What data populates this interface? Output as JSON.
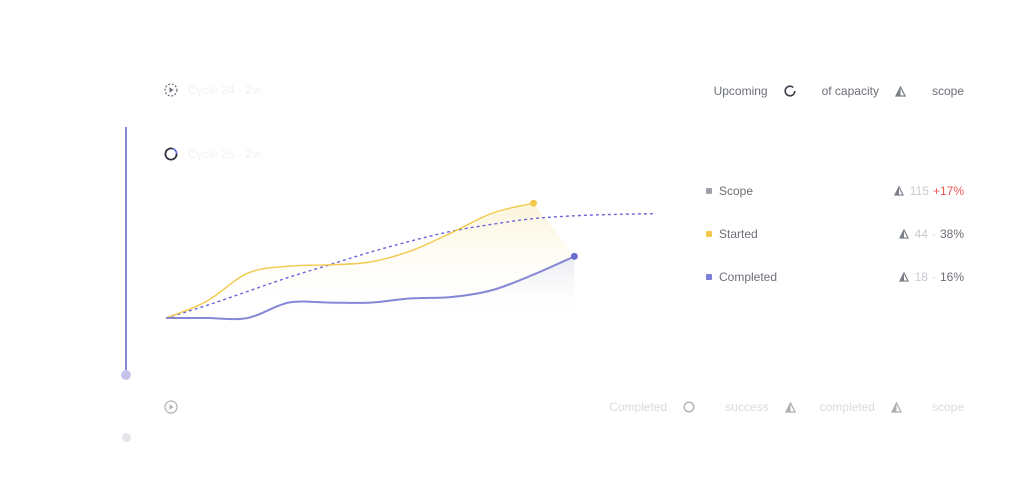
{
  "previous_cycle": {
    "name": "Cycle 24 · 2w"
  },
  "active_cycle": {
    "name": "Cycle 25 · 2w",
    "upcoming_label": "Upcoming",
    "capacity_label": "of capacity",
    "scope_label": "scope"
  },
  "next_cycle": {
    "completed_label": "Completed",
    "success_label": "success",
    "completed_count_label": "completed",
    "scope_label": "scope"
  },
  "legend": [
    {
      "label": "Scope",
      "count": "115",
      "change": "+17%",
      "color": "#9ea1a8"
    },
    {
      "label": "Started",
      "count": "44",
      "percent": "38%",
      "color": "#f2c94c"
    },
    {
      "label": "Completed",
      "count": "18",
      "percent": "16%",
      "color": "#7c7fd3"
    }
  ],
  "chart_data": {
    "type": "line",
    "x": [
      0,
      1,
      2,
      3,
      4,
      5,
      6,
      7,
      8,
      9,
      10,
      11,
      12
    ],
    "series": [
      {
        "name": "Scope",
        "style": "dashed",
        "values": [
          0,
          9,
          19,
          29,
          38,
          47,
          55,
          62,
          67,
          71,
          73,
          74,
          74.5
        ]
      },
      {
        "name": "Started",
        "values": [
          0,
          12,
          32,
          37,
          38,
          40,
          48,
          61,
          75,
          82
        ]
      },
      {
        "name": "Completed",
        "values": [
          0,
          0,
          0,
          11,
          11,
          11,
          14,
          15,
          20,
          31,
          44
        ]
      }
    ],
    "ylim": [
      0,
      100
    ],
    "colors": {
      "Scope": "#6a65d8",
      "Started": "#f2c94c",
      "Completed": "#8688d6"
    },
    "grid": false,
    "legend_position": "right"
  }
}
